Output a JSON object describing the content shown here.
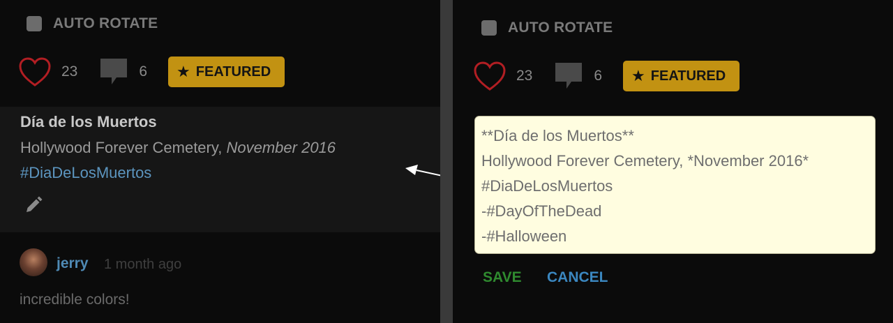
{
  "left_panel": {
    "auto_rotate_label": "AUTO ROTATE",
    "likes": "23",
    "comments": "6",
    "featured_label": "FEATURED",
    "description": {
      "title": "Día de los Muertos",
      "location": "Hollywood Forever Cemetery,",
      "date": "November 2016",
      "tag": "#DiaDeLosMuertos"
    },
    "comment": {
      "author": "jerry",
      "time": "1 month ago",
      "text": "incredible colors!"
    }
  },
  "right_panel": {
    "auto_rotate_label": "AUTO ROTATE",
    "likes": "23",
    "comments": "6",
    "featured_label": "FEATURED",
    "editor_lines": [
      "**Día de los Muertos**",
      "Hollywood Forever Cemetery, *November 2016*",
      "#DiaDeLosMuertos",
      "-#DayOfTheDead",
      "-#Halloween"
    ],
    "save_label": "SAVE",
    "cancel_label": "CANCEL"
  },
  "icons": {
    "heart": "heart-icon",
    "comment": "comment-icon",
    "star": "star-icon",
    "edit": "pencil-icon",
    "checkbox": "checkbox-icon",
    "arrow": "arrow-annotation"
  },
  "colors": {
    "background": "#0b0b0b",
    "featured": "#c29212",
    "heart": "#b21e23",
    "link": "#5c95bf",
    "save": "#2f8a2f",
    "cancel": "#3b87c0",
    "editor_bg": "#fffde0"
  }
}
